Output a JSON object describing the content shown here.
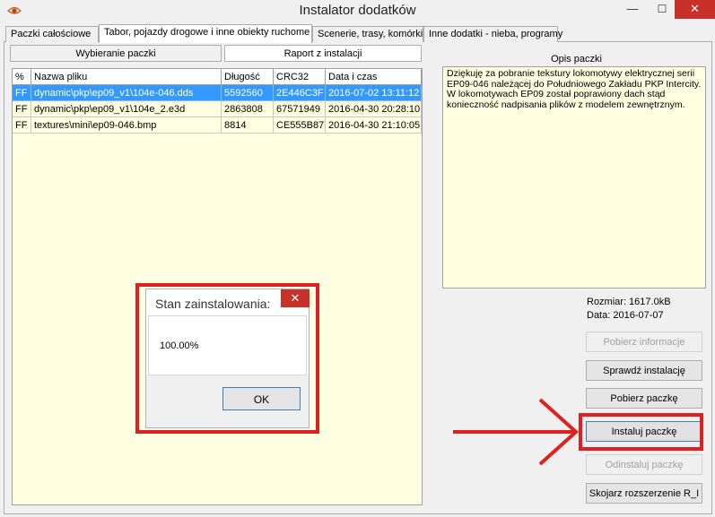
{
  "window": {
    "title": "Instalator dodatków",
    "minimize": "—",
    "maximize": "☐",
    "close": "✕"
  },
  "tabs": [
    {
      "label": "Paczki całościowe"
    },
    {
      "label": "Tabor, pojazdy drogowe i inne obiekty ruchome"
    },
    {
      "label": "Scenerie, trasy, komórki"
    },
    {
      "label": "Inne dodatki - nieba, programy"
    }
  ],
  "subtabs": [
    {
      "label": "Wybieranie paczki"
    },
    {
      "label": "Raport z instalacji"
    }
  ],
  "grid": {
    "headers": [
      "%",
      "Nazwa pliku",
      "Długość",
      "CRC32",
      "Data i czas"
    ],
    "rows": [
      {
        "pct": "FF",
        "name": "dynamic\\pkp\\ep09_v1\\104e-046.dds",
        "len": "5592560",
        "crc": "2E446C3F",
        "date": "2016-07-02 13:11:12"
      },
      {
        "pct": "FF",
        "name": "dynamic\\pkp\\ep09_v1\\104e_2.e3d",
        "len": "2863808",
        "crc": "67571949",
        "date": "2016-04-30 20:28:10"
      },
      {
        "pct": "FF",
        "name": "textures\\mini\\ep09-046.bmp",
        "len": "8814",
        "crc": "CE555B87",
        "date": "2016-04-30 21:10:05"
      }
    ]
  },
  "description": {
    "label": "Opis paczki",
    "text": "Dziękuję za pobranie tekstury lokomotywy elektrycznej serii EP09-046 należącej do Południowego Zakładu PKP Intercity. W lokomotywach EP09 został poprawiony dach stąd konieczność nadpisania plików z modelem zewnętrznym."
  },
  "info": {
    "size": "Rozmiar: 1617.0kB",
    "date": "Data: 2016-07-07"
  },
  "buttons": {
    "get_info": "Pobierz informacje",
    "check_install": "Sprawdź instalację",
    "download": "Pobierz paczkę",
    "install": "Instaluj paczkę",
    "uninstall": "Odinstaluj paczkę",
    "associate": "Skojarz rozszerzenie R_I"
  },
  "dialog": {
    "title": "Stan zainstalowania:",
    "message": "100.00%",
    "ok": "OK",
    "close": "✕"
  },
  "colors": {
    "selection": "#3399ff",
    "grid_background": "#ffffe1",
    "highlight": "#e02020"
  }
}
